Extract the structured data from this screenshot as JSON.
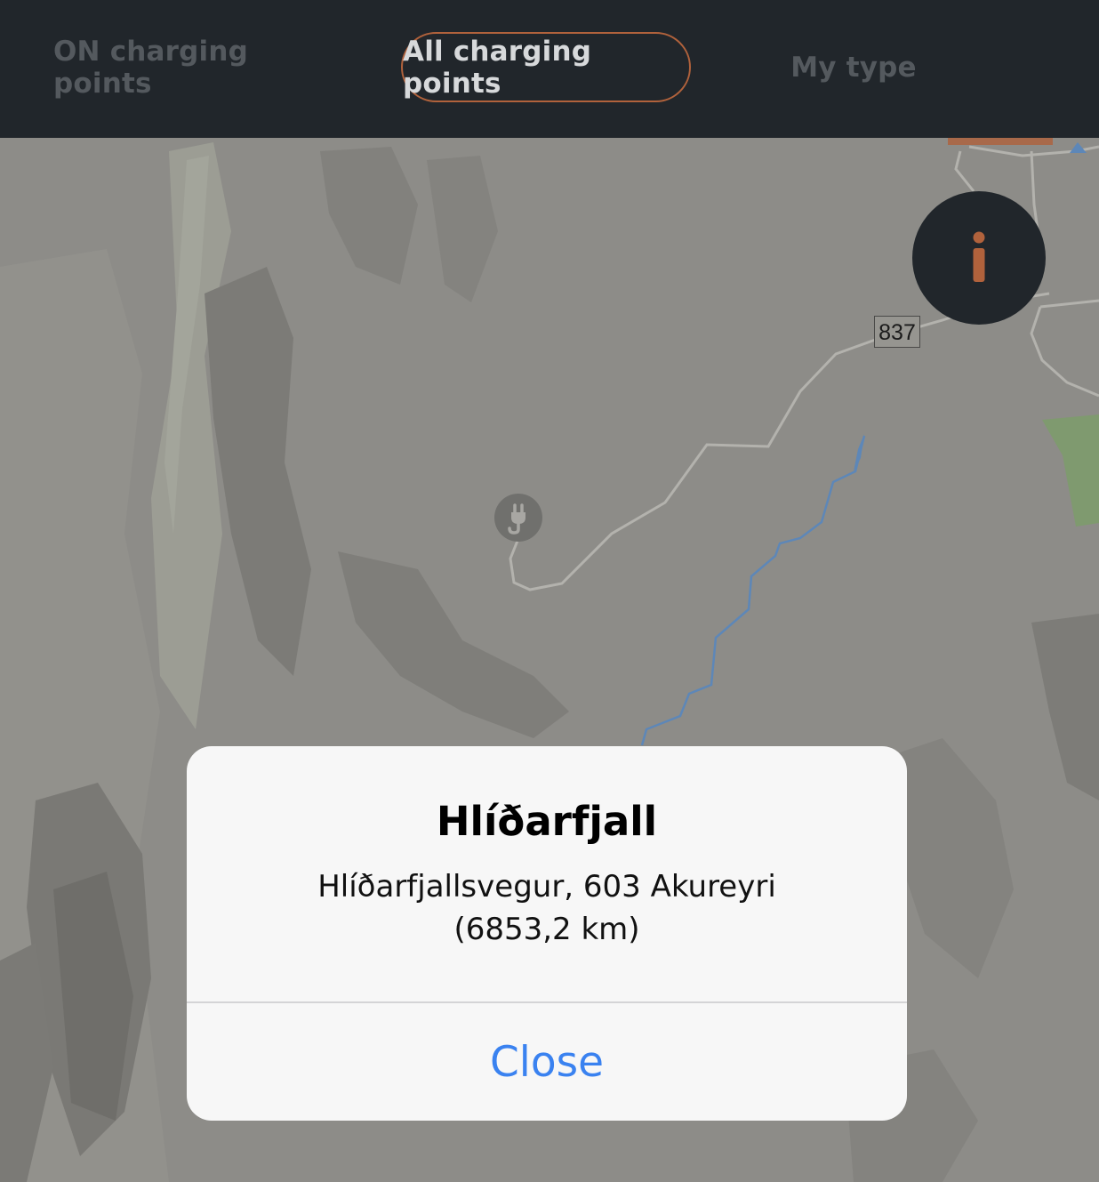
{
  "tabs": {
    "on": "ON charging points",
    "all": "All charging points",
    "my": "My type"
  },
  "map": {
    "road_number": "837"
  },
  "info_button": {
    "icon": "info-icon",
    "color": "#b1623c"
  },
  "alert": {
    "title": "Hlíðarfjall",
    "address": "Hlíðarfjallsvegur, 603 Akureyri",
    "distance": "(6853,2 km)",
    "close_label": "Close"
  },
  "colors": {
    "topbar": "#21262b",
    "accent": "#b1623c",
    "link": "#3a82f0",
    "map_base": "#8d8c88"
  }
}
